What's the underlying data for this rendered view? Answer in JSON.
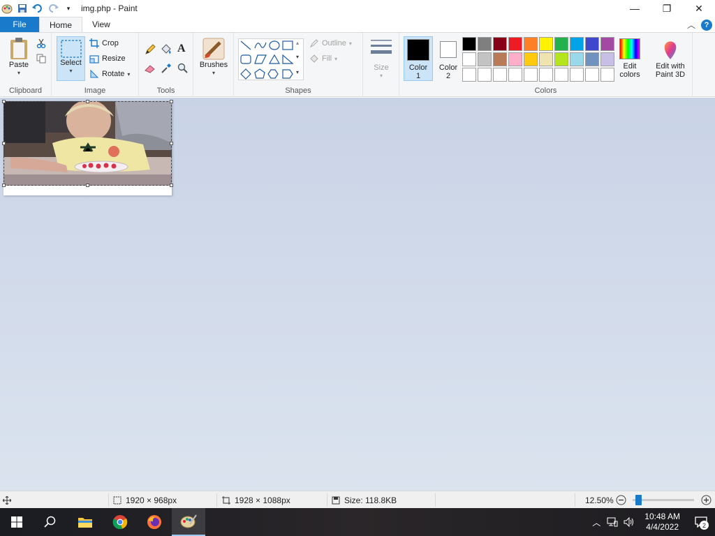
{
  "window": {
    "title": "img.php - Paint",
    "controls": {
      "minimize": "—",
      "restore": "❐",
      "close": "✕"
    }
  },
  "tabs": {
    "file": "File",
    "home": "Home",
    "view": "View"
  },
  "ribbon": {
    "clipboard": {
      "label": "Clipboard",
      "paste": "Paste"
    },
    "image": {
      "label": "Image",
      "select": "Select",
      "crop": "Crop",
      "resize": "Resize",
      "rotate": "Rotate"
    },
    "tools": {
      "label": "Tools"
    },
    "brushes": {
      "label": "Brushes"
    },
    "shapes": {
      "label": "Shapes",
      "outline": "Outline",
      "fill": "Fill"
    },
    "size": {
      "label": "Size"
    },
    "colors": {
      "label": "Colors",
      "color1_line1": "Color",
      "color1_line2": "1",
      "color2_line1": "Color",
      "color2_line2": "2",
      "edit_colors_line1": "Edit",
      "edit_colors_line2": "colors",
      "paint3d_line1": "Edit with",
      "paint3d_line2": "Paint 3D",
      "color1_value": "#000000",
      "color2_value": "#ffffff",
      "palette": [
        "#000000",
        "#7f7f7f",
        "#880015",
        "#ed1c24",
        "#ff7f27",
        "#fff200",
        "#22b14c",
        "#00a2e8",
        "#3f48cc",
        "#a349a4",
        "#ffffff",
        "#c3c3c3",
        "#b97a57",
        "#ffaec9",
        "#ffc90e",
        "#efe4b0",
        "#b5e61d",
        "#99d9ea",
        "#7092be",
        "#c8bfe7",
        "#ffffff",
        "#ffffff",
        "#ffffff",
        "#ffffff",
        "#ffffff",
        "#ffffff",
        "#ffffff",
        "#ffffff",
        "#ffffff",
        "#ffffff"
      ]
    }
  },
  "status": {
    "selection_size": "1920 × 968px",
    "image_size": "1928 × 1088px",
    "file_size": "Size: 118.8KB",
    "zoom": "12.50%",
    "zoom_level_fraction": 0.04
  },
  "taskbar": {
    "time": "10:48 AM",
    "date": "4/4/2022",
    "notification_count": "2"
  }
}
